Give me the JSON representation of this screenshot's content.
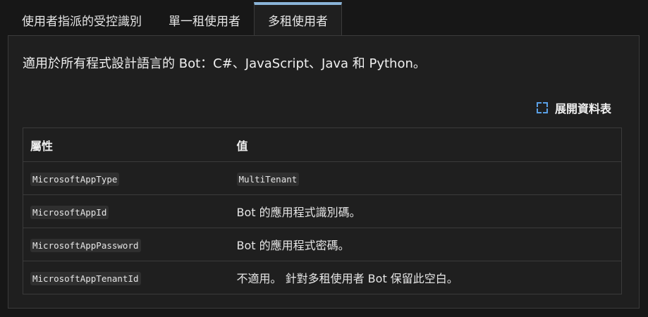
{
  "tabs": [
    {
      "label": "使用者指派的受控識別",
      "active": false
    },
    {
      "label": "單一租使用者",
      "active": false
    },
    {
      "label": "多租使用者",
      "active": true
    }
  ],
  "intro": "適用於所有程式設計語言的 Bot：C#、JavaScript、Java 和 Python。",
  "expand_table_label": "展開資料表",
  "table": {
    "headers": [
      "屬性",
      "值"
    ],
    "rows": [
      {
        "property": "MicrosoftAppType",
        "value": "MultiTenant",
        "value_is_code": true
      },
      {
        "property": "MicrosoftAppId",
        "value": "Bot 的應用程式識別碼。",
        "value_is_code": false
      },
      {
        "property": "MicrosoftAppPassword",
        "value": "Bot 的應用程式密碼。",
        "value_is_code": false
      },
      {
        "property": "MicrosoftAppTenantId",
        "value": "不適用。 針對多租使用者 Bot 保留此空白。",
        "value_is_code": false
      }
    ]
  },
  "colors": {
    "background": "#171717",
    "panel": "#1f1f1f",
    "border": "#3b3b3b",
    "active_tab_accent": "#8ab4d8",
    "expand_icon": "#5aa0e6"
  },
  "icons": {
    "expand": "expand-icon"
  }
}
